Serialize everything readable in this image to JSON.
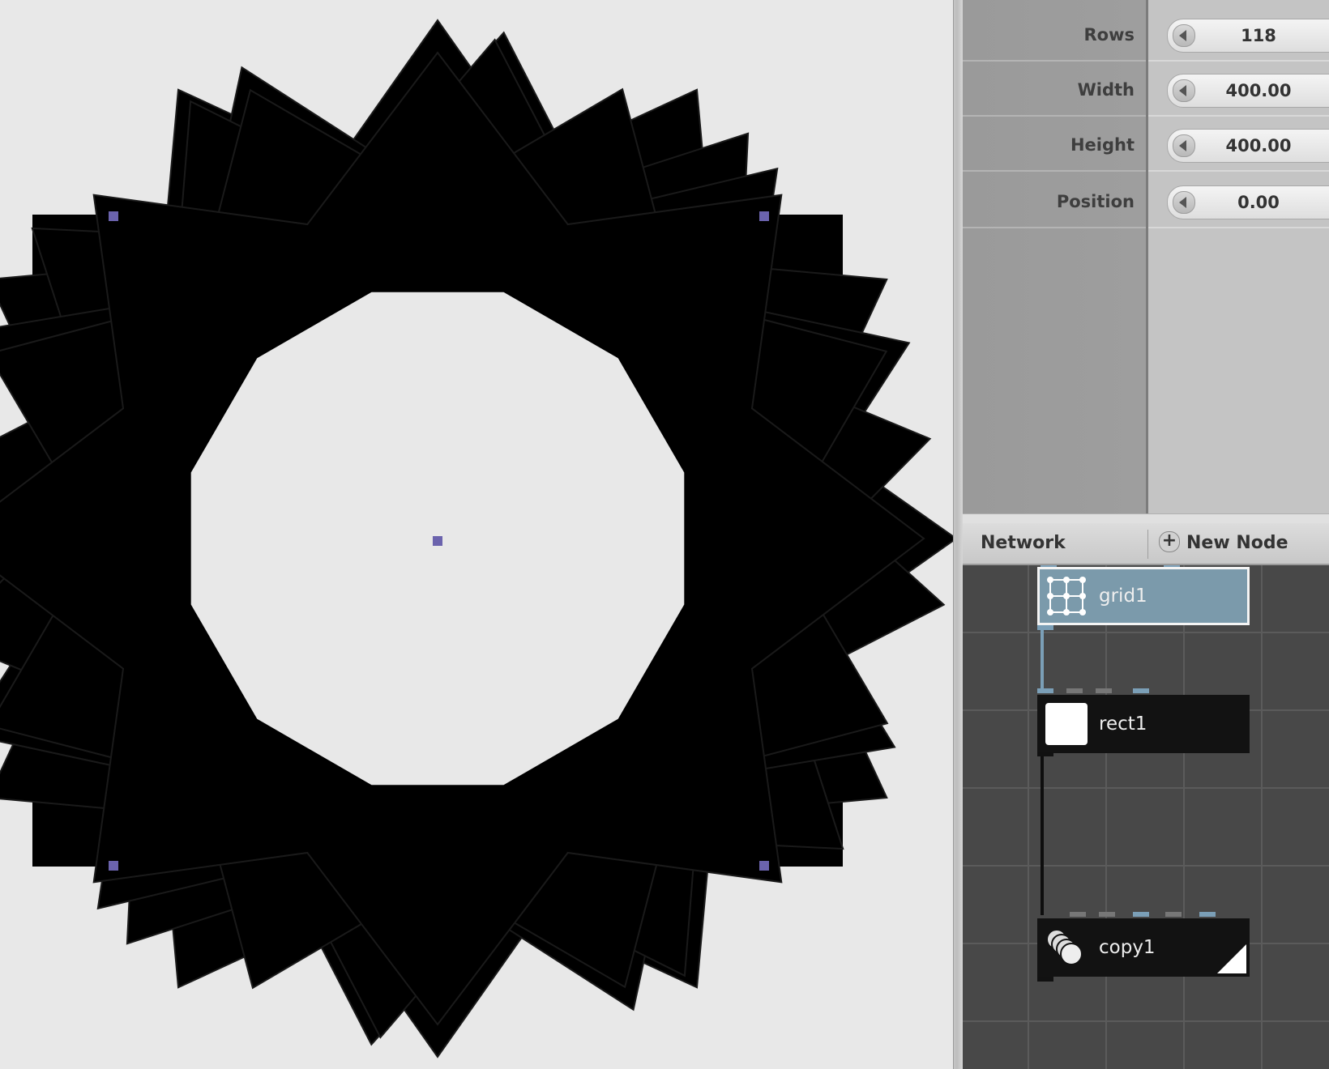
{
  "viewer": {
    "handles": [
      "handle-top-left",
      "handle-top-right",
      "handle-center",
      "handle-bottom-left",
      "handle-bottom-right"
    ]
  },
  "parameters": {
    "rows": [
      {
        "label": "Rows",
        "value": "118"
      },
      {
        "label": "Width",
        "value": "400.00"
      },
      {
        "label": "Height",
        "value": "400.00"
      },
      {
        "label": "Position",
        "value": "0.00"
      }
    ]
  },
  "network": {
    "title": "Network",
    "new_node_label": "New Node",
    "new_node_icon": "plus-icon",
    "nodes": [
      {
        "name": "grid1",
        "icon": "grid-icon",
        "selected": true
      },
      {
        "name": "rect1",
        "icon": "rect-icon",
        "selected": false
      },
      {
        "name": "copy1",
        "icon": "copy-icon",
        "selected": false,
        "rendered": true
      }
    ]
  },
  "colors": {
    "handle": "#6b63ad",
    "selected_node": "#7b9aab",
    "connection": "#7b9fb7"
  }
}
